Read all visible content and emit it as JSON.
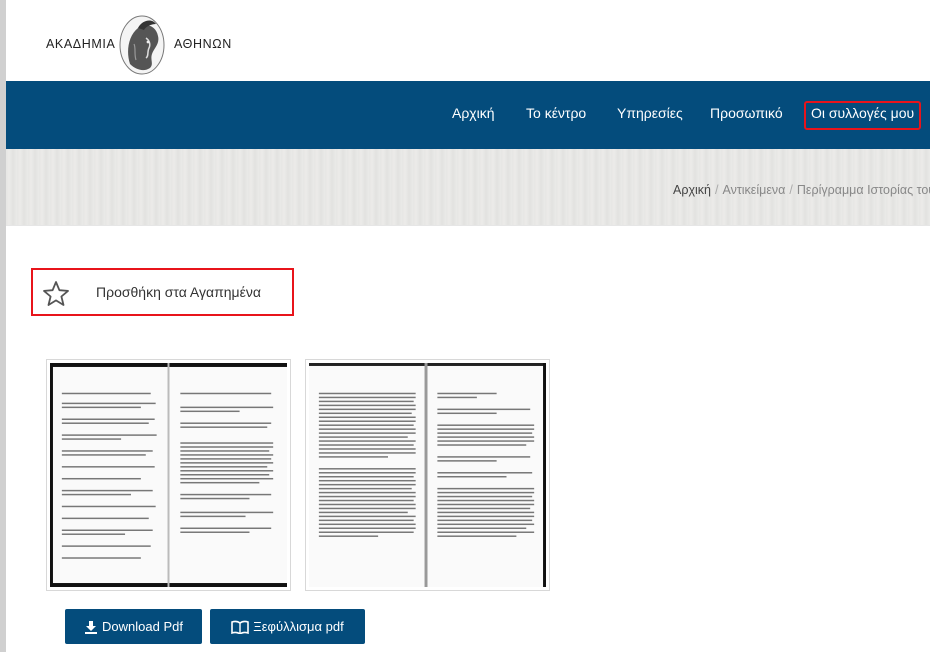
{
  "logo": {
    "text_left": "ΑΚΑΔΗΜΙΑ",
    "text_right": "ΑΘΗΝΩΝ",
    "emblem": "athena-head-emblem"
  },
  "nav": {
    "items": [
      {
        "label": "Αρχική"
      },
      {
        "label": "Το κέντρο"
      },
      {
        "label": "Υπηρεσίες"
      },
      {
        "label": "Προσωπικό"
      },
      {
        "label": "Οι συλλογές μου"
      }
    ],
    "highlight_color": "#e8141b",
    "background": "#044c7c"
  },
  "breadcrumb": {
    "home": "Αρχική",
    "items": [
      "Αντικείμενα",
      "Περίγραμμα Ιστορίας του"
    ]
  },
  "favorite": {
    "label": "Προσθήκη στα Αγαπημένα",
    "icon": "star-outline-icon"
  },
  "thumbnails": [
    {
      "page_left": "Page spread 1",
      "icon": "document-scan"
    },
    {
      "page_left": "Page spread 2",
      "icon": "document-scan"
    }
  ],
  "buttons": {
    "download_label": "Download Pdf",
    "download_icon": "download-icon",
    "flip_label": "Ξεφύλλισμα pdf",
    "flip_icon": "open-book-icon"
  }
}
